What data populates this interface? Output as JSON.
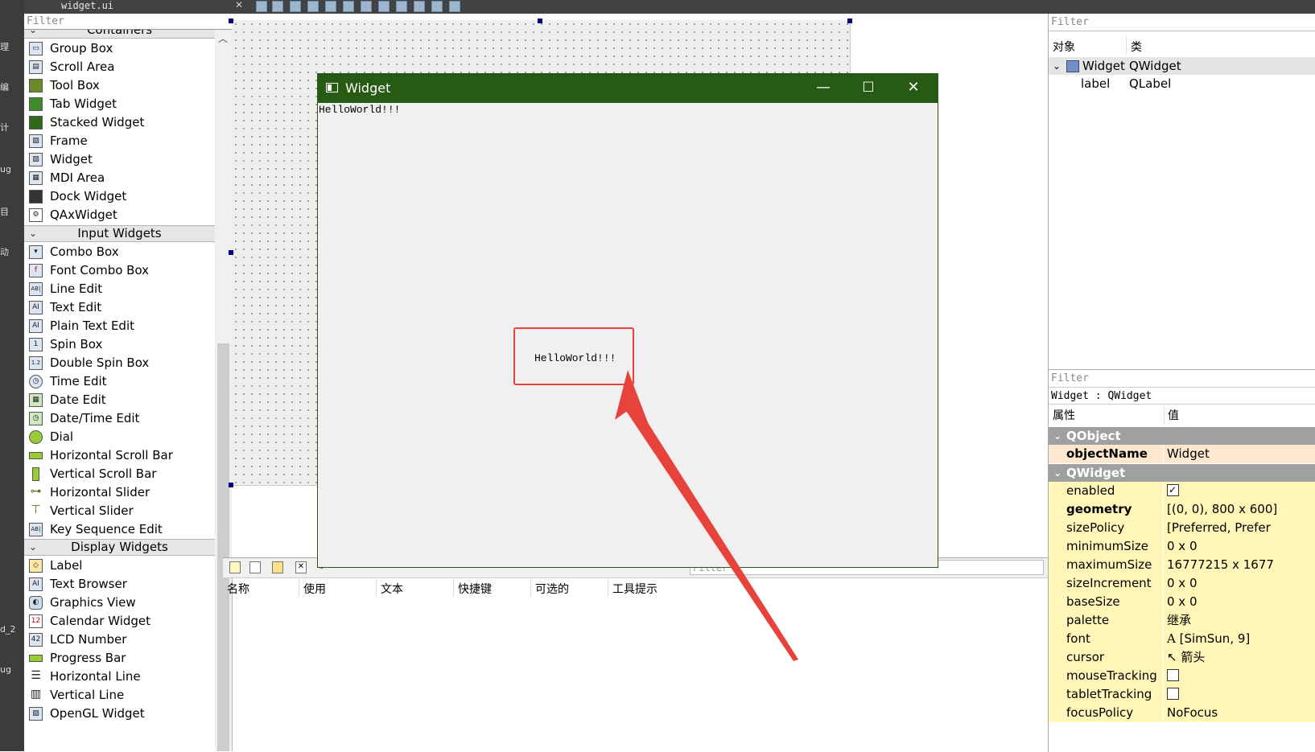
{
  "topbar": {
    "file_name": "widget.ui"
  },
  "modebar": {
    "items": [
      "理",
      "编",
      "计",
      "ug",
      "目",
      "动",
      "d_2",
      "ug"
    ]
  },
  "widgetbox": {
    "filter_placeholder": "Filter",
    "categories": [
      {
        "name": "Containers",
        "items": [
          "Group Box",
          "Scroll Area",
          "Tool Box",
          "Tab Widget",
          "Stacked Widget",
          "Frame",
          "Widget",
          "MDI Area",
          "Dock Widget",
          "QAxWidget"
        ]
      },
      {
        "name": "Input Widgets",
        "items": [
          "Combo Box",
          "Font Combo Box",
          "Line Edit",
          "Text Edit",
          "Plain Text Edit",
          "Spin Box",
          "Double Spin Box",
          "Time Edit",
          "Date Edit",
          "Date/Time Edit",
          "Dial",
          "Horizontal Scroll Bar",
          "Vertical Scroll Bar",
          "Horizontal Slider",
          "Vertical Slider",
          "Key Sequence Edit"
        ]
      },
      {
        "name": "Display Widgets",
        "items": [
          "Label",
          "Text Browser",
          "Graphics View",
          "Calendar Widget",
          "LCD Number",
          "Progress Bar",
          "Horizontal Line",
          "Vertical Line",
          "OpenGL Widget"
        ]
      }
    ]
  },
  "preview": {
    "title": "Widget",
    "label_text_top": "HelloWorld!!!",
    "label_text_center": "HelloWorld!!!",
    "minimize": "—",
    "maximize": "☐",
    "close": "✕"
  },
  "action_editor": {
    "filter_placeholder": "Filter",
    "columns": [
      "名称",
      "使用",
      "文本",
      "快捷键",
      "可选的",
      "工具提示"
    ]
  },
  "object_inspector": {
    "filter_placeholder": "Filter",
    "col_object": "对象",
    "col_class": "类",
    "rows": [
      {
        "object": "Widget",
        "class": "QWidget"
      },
      {
        "object": "label",
        "class": "QLabel"
      }
    ]
  },
  "property_editor": {
    "filter_placeholder": "Filter",
    "class_line": "Widget : QWidget",
    "col_property": "属性",
    "col_value": "值",
    "sections": [
      {
        "name": "QObject",
        "rows": [
          {
            "name": "objectName",
            "value": "Widget",
            "bold": true
          }
        ]
      },
      {
        "name": "QWidget",
        "rows": [
          {
            "name": "enabled",
            "value": ""
          },
          {
            "name": "geometry",
            "value": "[(0, 0), 800 x 600]"
          },
          {
            "name": "sizePolicy",
            "value": "[Preferred, Prefer"
          },
          {
            "name": "minimumSize",
            "value": "0 x 0"
          },
          {
            "name": "maximumSize",
            "value": "16777215 x 1677"
          },
          {
            "name": "sizeIncrement",
            "value": "0 x 0"
          },
          {
            "name": "baseSize",
            "value": "0 x 0"
          },
          {
            "name": "palette",
            "value": "继承"
          },
          {
            "name": "font",
            "value": "[SimSun, 9]"
          },
          {
            "name": "cursor",
            "value": "箭头"
          },
          {
            "name": "mouseTracking",
            "value": ""
          },
          {
            "name": "tabletTracking",
            "value": ""
          },
          {
            "name": "focusPolicy",
            "value": "NoFocus"
          }
        ]
      }
    ]
  },
  "colors": {
    "title_green": "#275a12",
    "highlight_red": "#e8423c",
    "prop_yellow": "#fff6b8"
  }
}
